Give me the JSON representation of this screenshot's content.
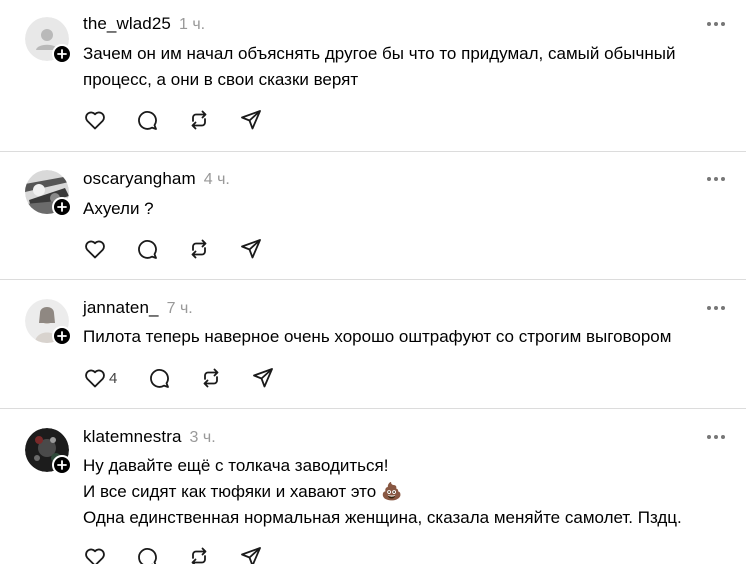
{
  "posts": [
    {
      "username": "the_wlad25",
      "time": "1 ч.",
      "lines": [
        "Зачем он им начал объяснять другое бы что то придумал, самый обычный",
        "процесс, а они в свои сказки верят"
      ],
      "likes": ""
    },
    {
      "username": "oscaryangham",
      "time": "4 ч.",
      "lines": [
        "Ахуели ?"
      ],
      "likes": ""
    },
    {
      "username": "jannaten_",
      "time": "7 ч.",
      "lines": [
        "Пилота теперь наверное очень хорошо оштрафуют со строгим выговором"
      ],
      "likes": "4"
    },
    {
      "username": "klatemnestra",
      "time": "3 ч.",
      "lines": [
        "Ну давайте ещё с толкача заводиться!",
        "И все сидят как тюфяки и хавают это 💩",
        "Одна единственная нормальная женщина, сказала меняйте самолет. Пздц."
      ],
      "likes": ""
    }
  ],
  "icons": {
    "like": "heart-icon",
    "comment": "comment-icon",
    "repost": "repost-icon",
    "share": "share-icon",
    "more": "more-icon",
    "follow": "plus-icon"
  }
}
